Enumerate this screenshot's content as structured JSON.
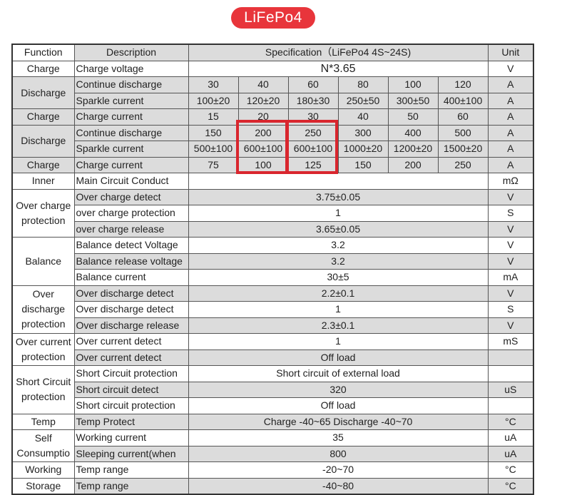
{
  "badge": "LiFePo4",
  "header": {
    "function": "Function",
    "description": "Description",
    "specification": "Specification（LiFePo4 4S~24S)",
    "unit": "Unit"
  },
  "rows": {
    "charge_voltage": {
      "function": "Charge",
      "desc": "Charge voltage",
      "value": "N*3.65",
      "unit": "V"
    },
    "discharge1": {
      "function": "Discharge",
      "continue": {
        "desc": "Continue discharge",
        "values": [
          "30",
          "40",
          "60",
          "80",
          "100",
          "120"
        ],
        "unit": "A"
      },
      "sparkle": {
        "desc": "Sparkle current",
        "values": [
          "100±20",
          "120±20",
          "180±30",
          "250±50",
          "300±50",
          "400±100"
        ],
        "unit": "A"
      }
    },
    "charge1": {
      "function": "Charge",
      "desc": "Charge current",
      "values": [
        "15",
        "20",
        "30",
        "40",
        "50",
        "60"
      ],
      "unit": "A"
    },
    "discharge2": {
      "function": "Discharge",
      "continue": {
        "desc": "Continue discharge",
        "values": [
          "150",
          "200",
          "250",
          "300",
          "400",
          "500"
        ],
        "unit": "A"
      },
      "sparkle": {
        "desc": "Sparkle current",
        "values": [
          "500±100",
          "600±100",
          "600±100",
          "1000±20",
          "1200±20",
          "1500±20"
        ],
        "unit": "A"
      }
    },
    "charge2": {
      "function": "Charge",
      "desc": "Charge current",
      "values": [
        "75",
        "100",
        "125",
        "150",
        "200",
        "250"
      ],
      "unit": "A"
    },
    "inner": {
      "function": "Inner",
      "desc": "Main Circuit Conduct",
      "value": "",
      "unit": "mΩ"
    },
    "over_charge": {
      "function": "Over charge protection",
      "items": [
        {
          "desc": "Over charge detect",
          "value": "3.75±0.05",
          "unit": "V"
        },
        {
          "desc": "over charge protection",
          "value": "1",
          "unit": "S"
        },
        {
          "desc": "over charge release",
          "value": "3.65±0.05",
          "unit": "V"
        }
      ]
    },
    "balance": {
      "function": "Balance",
      "items": [
        {
          "desc": "Balance detect Voltage",
          "value": "3.2",
          "unit": "V"
        },
        {
          "desc": "Balance release voltage",
          "value": "3.2",
          "unit": "V"
        },
        {
          "desc": "Balance current",
          "value": "30±5",
          "unit": "mA"
        }
      ]
    },
    "over_discharge": {
      "function": "Over discharge protection",
      "items": [
        {
          "desc": "Over discharge detect",
          "value": "2.2±0.1",
          "unit": "V"
        },
        {
          "desc": "Over discharge detect",
          "value": "1",
          "unit": "S"
        },
        {
          "desc": "Over discharge release",
          "value": "2.3±0.1",
          "unit": "V"
        }
      ]
    },
    "over_current": {
      "function": "Over current protection",
      "items": [
        {
          "desc": "Over current detect",
          "value": "1",
          "unit": "mS"
        },
        {
          "desc": "Over current detect",
          "value": "Off load",
          "unit": ""
        }
      ]
    },
    "short_circuit": {
      "function": "Short Circuit protection",
      "items": [
        {
          "desc": "Short Circuit protection",
          "value": "Short circuit of external load",
          "unit": ""
        },
        {
          "desc": "Short circuit detect",
          "value": "320",
          "unit": "uS"
        },
        {
          "desc": "Short circuit protection",
          "value": "Off load",
          "unit": ""
        }
      ]
    },
    "temp": {
      "function": "Temp",
      "desc": "Temp Protect",
      "value": "Charge -40~65 Discharge -40~70",
      "unit": "°C"
    },
    "self_consumption": {
      "function": "Self Consumptio",
      "items": [
        {
          "desc": "Working current",
          "value": "35",
          "unit": "uA"
        },
        {
          "desc": "Sleeping current(when",
          "value": "800",
          "unit": "uA"
        }
      ]
    },
    "working": {
      "function": "Working",
      "desc": "Temp range",
      "value": "-20~70",
      "unit": "°C"
    },
    "storage": {
      "function": "Storage",
      "desc": "Temp range",
      "value": "-40~80",
      "unit": "°C"
    }
  },
  "highlight_color": "#d9262e",
  "badge_color": "#e8353b"
}
